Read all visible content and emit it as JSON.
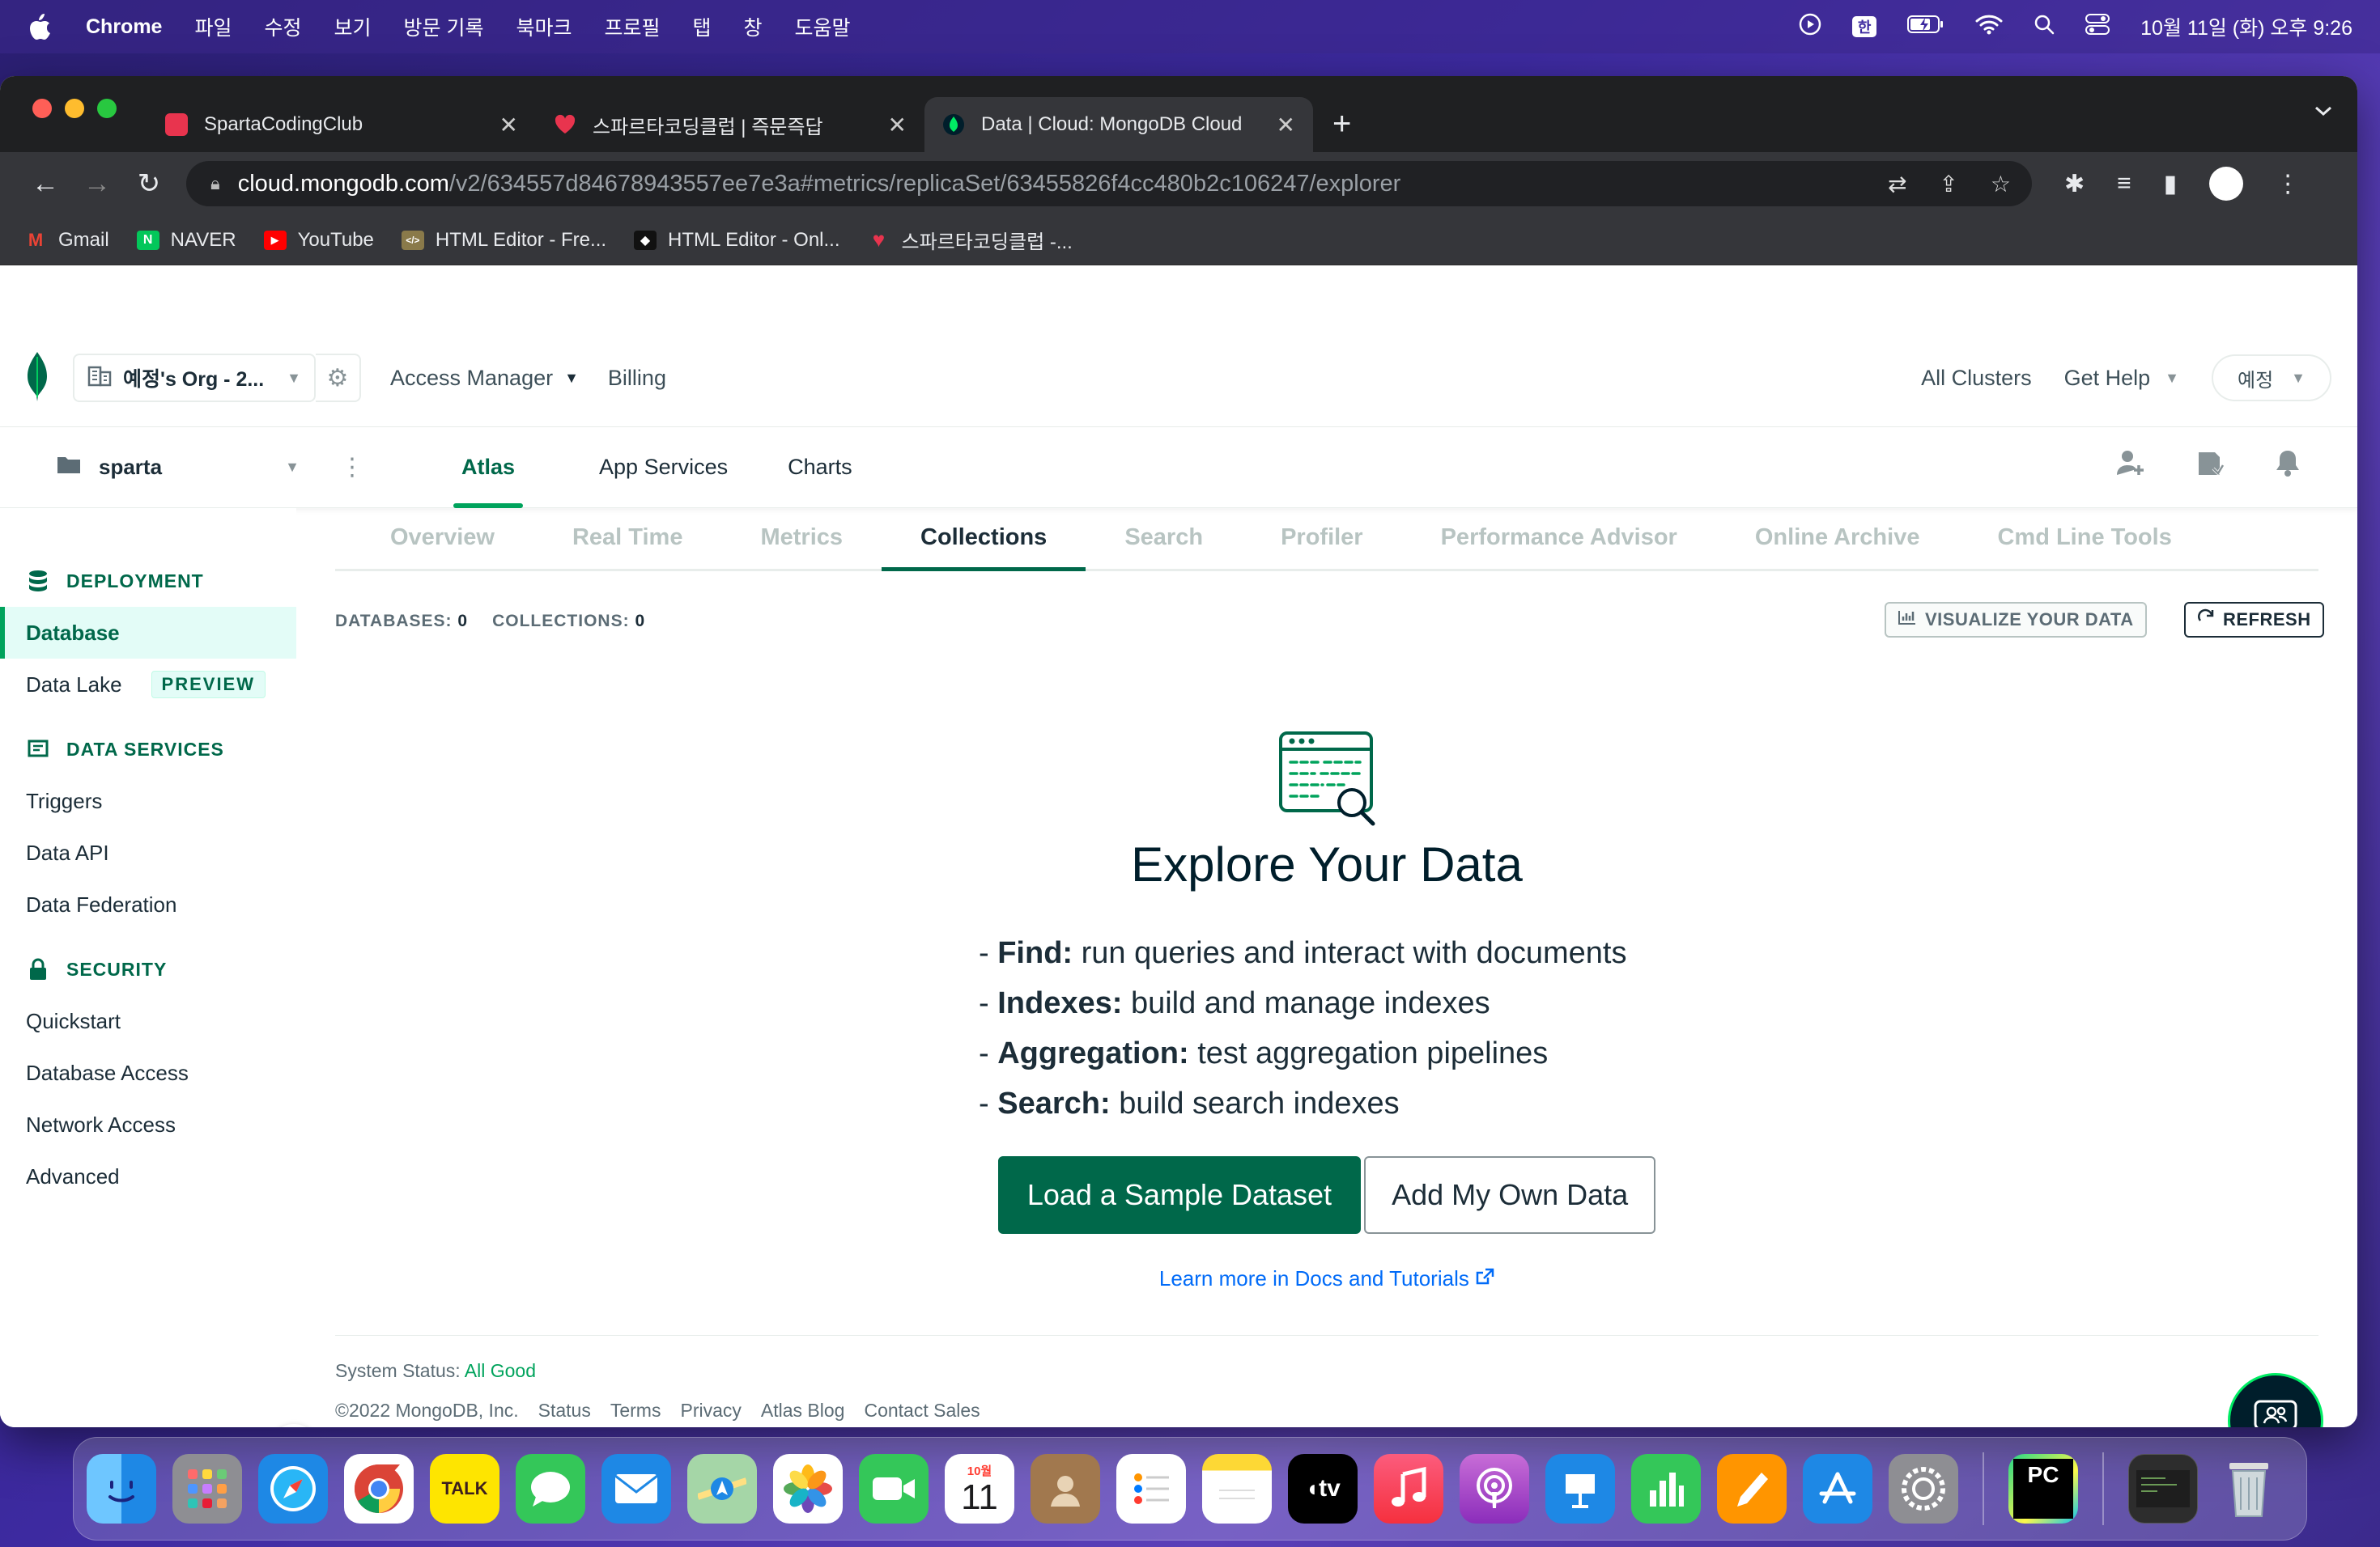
{
  "menubar": {
    "app_name": "Chrome",
    "menus": [
      "파일",
      "수정",
      "보기",
      "방문 기록",
      "북마크",
      "프로필",
      "탭",
      "창",
      "도움말"
    ],
    "input_method": "한",
    "datetime": "10월 11일 (화) 오후 9:26"
  },
  "browser": {
    "tabs": [
      {
        "title": "SpartaCodingClub",
        "color": "#e8344e"
      },
      {
        "title": "스파르타코딩클럽 | 즉문즉답",
        "color": "#e8344e"
      },
      {
        "title": "Data | Cloud: MongoDB Cloud",
        "color": "#00ed64"
      }
    ],
    "url_host": "cloud.mongodb.com",
    "url_path": "/v2/634557d84678943557ee7e3a#metrics/replicaSet/63455826f4cc480b2c106247/explorer",
    "bookmarks": [
      {
        "label": "Gmail",
        "icon": "M",
        "color": "#ea4335"
      },
      {
        "label": "NAVER",
        "icon": "N",
        "color": "#03c75a"
      },
      {
        "label": "YouTube",
        "icon": "▶",
        "color": "#ff0000"
      },
      {
        "label": "HTML Editor - Fre...",
        "icon": "</>",
        "color": "#8a7a4a"
      },
      {
        "label": "HTML Editor - Onl...",
        "icon": "◆",
        "color": "#222222"
      },
      {
        "label": "스파르타코딩클럽 -...",
        "icon": "♥",
        "color": "#e8344e"
      }
    ]
  },
  "header": {
    "org_name": "예정's Org - 2...",
    "access_manager": "Access Manager",
    "billing": "Billing",
    "all_clusters": "All Clusters",
    "get_help": "Get Help",
    "user": "예정"
  },
  "project": {
    "name": "sparta",
    "tabs": [
      "Atlas",
      "App Services",
      "Charts"
    ]
  },
  "sidebar": {
    "deployment": {
      "title": "DEPLOYMENT",
      "items": [
        "Database",
        "Data Lake"
      ],
      "data_lake_badge": "PREVIEW"
    },
    "data_services": {
      "title": "DATA SERVICES",
      "items": [
        "Triggers",
        "Data API",
        "Data Federation"
      ]
    },
    "security": {
      "title": "SECURITY",
      "items": [
        "Quickstart",
        "Database Access",
        "Network Access",
        "Advanced"
      ]
    }
  },
  "cluster_tabs": [
    "Overview",
    "Real Time",
    "Metrics",
    "Collections",
    "Search",
    "Profiler",
    "Performance Advisor",
    "Online Archive",
    "Cmd Line Tools"
  ],
  "counts": {
    "databases_label": "DATABASES:",
    "databases": "0",
    "collections_label": "COLLECTIONS:",
    "collections": "0"
  },
  "actions": {
    "visualize": "VISUALIZE YOUR DATA",
    "refresh": "REFRESH"
  },
  "explore": {
    "title": "Explore Your Data",
    "features": [
      {
        "name": "Find:",
        "desc": "run queries and interact with documents"
      },
      {
        "name": "Indexes:",
        "desc": "build and manage indexes"
      },
      {
        "name": "Aggregation:",
        "desc": "test aggregation pipelines"
      },
      {
        "name": "Search:",
        "desc": "build search indexes"
      }
    ],
    "load_sample": "Load a Sample Dataset",
    "add_own": "Add My Own Data",
    "learn_more": "Learn more in Docs and Tutorials"
  },
  "footer": {
    "status_label": "System Status:",
    "status_value": "All Good",
    "copyright": "©2022 MongoDB, Inc.",
    "links": [
      "Status",
      "Terms",
      "Privacy",
      "Atlas Blog",
      "Contact Sales"
    ]
  },
  "dock": {
    "calendar_month": "10월",
    "calendar_day": "11",
    "talk": "TALK",
    "tv": "tv",
    "pycharm": "PC"
  }
}
